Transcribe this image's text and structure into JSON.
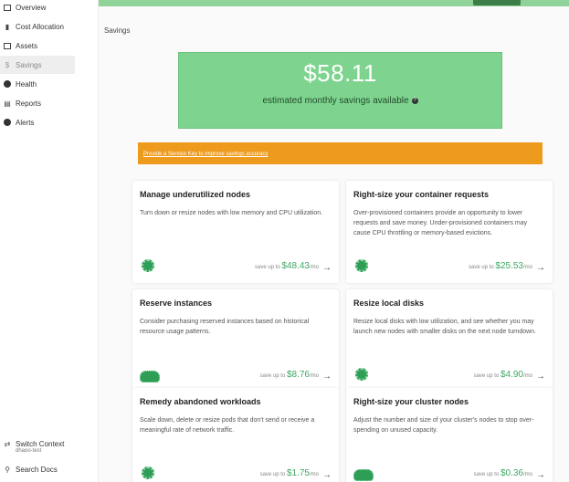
{
  "sidebar": {
    "items": [
      {
        "label": "Overview",
        "icon": "overview-icon"
      },
      {
        "label": "Cost Allocation",
        "icon": "bar-chart-icon"
      },
      {
        "label": "Assets",
        "icon": "assets-icon"
      },
      {
        "label": "Savings",
        "icon": "dollar-icon"
      },
      {
        "label": "Health",
        "icon": "health-icon"
      },
      {
        "label": "Reports",
        "icon": "reports-icon"
      },
      {
        "label": "Alerts",
        "icon": "alerts-icon"
      }
    ],
    "switch_context": {
      "label": "Switch Context",
      "sub": "dhaoo-test"
    },
    "search_docs": {
      "label": "Search Docs"
    }
  },
  "page": {
    "title": "Savings"
  },
  "hero": {
    "amount": "$58.11",
    "subtitle": "estimated monthly savings available",
    "color": "#7ed48f"
  },
  "warning": {
    "text": "Provide a Service Key to improve savings accuracy",
    "color": "#ee9a1c"
  },
  "cards": [
    {
      "title": "Manage underutilized nodes",
      "desc": "Turn down or resize nodes with low memory and CPU utilization.",
      "save_prefix": "save up to",
      "amount": "$48.43",
      "unit": "/mo"
    },
    {
      "title": "Right-size your container requests",
      "desc": "Over-provisioned containers provide an opportunity to lower requests and save money. Under-provisioned containers may cause CPU throttling or memory-based evictions.",
      "save_prefix": "save up to",
      "amount": "$25.53",
      "unit": "/mo"
    },
    {
      "title": "Reserve instances",
      "desc": "Consider purchasing reserved instances based on historical resource usage patterns.",
      "save_prefix": "save up to",
      "amount": "$8.76",
      "unit": "/mo"
    },
    {
      "title": "Resize local disks",
      "desc": "Resize local disks with low utilization, and see whether you may launch new nodes with smaller disks on the next node turndown.",
      "save_prefix": "save up to",
      "amount": "$4.90",
      "unit": "/mo"
    },
    {
      "title": "Remedy abandoned workloads",
      "desc": "Scale down, delete or resize pods that don't send or receive a meaningful rate of network traffic.",
      "save_prefix": "save up to",
      "amount": "$1.75",
      "unit": "/mo"
    },
    {
      "title": "Right-size your cluster nodes",
      "desc": "Adjust the number and size of your cluster's nodes to stop over-spending on unused capacity.",
      "save_prefix": "save up to",
      "amount": "$0.36",
      "unit": "/mo"
    }
  ]
}
